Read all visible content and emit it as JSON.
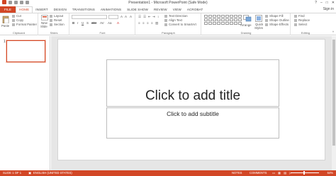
{
  "window": {
    "title": "Presentation1 - Microsoft PowerPoint (Safe Mode)",
    "controls": [
      "?",
      "–",
      "□",
      "✕"
    ],
    "sign_in": "Sign in"
  },
  "tabs": [
    "FILE",
    "HOME",
    "INSERT",
    "DESIGN",
    "TRANSITIONS",
    "ANIMATIONS",
    "SLIDE SHOW",
    "REVIEW",
    "VIEW",
    "ACROBAT"
  ],
  "ribbon": {
    "clipboard": {
      "label": "Clipboard",
      "paste": "Paste",
      "cut": "Cut",
      "copy": "Copy",
      "format_painter": "Format Painter"
    },
    "slides": {
      "label": "Slides",
      "new_slide": "New",
      "new_slide_2": "Slide",
      "layout": "Layout",
      "reset": "Reset",
      "section": "Section"
    },
    "font": {
      "label": "Font"
    },
    "paragraph": {
      "label": "Paragraph",
      "text_direction": "Text Direction",
      "align_text": "Align Text",
      "convert_smartart": "Convert to SmartArt"
    },
    "drawing": {
      "label": "Drawing",
      "arrange": "Arrange",
      "quick_styles": "Quick",
      "quick_styles_2": "Styles",
      "shape_fill": "Shape Fill",
      "shape_outline": "Shape Outline",
      "shape_effects": "Shape Effects"
    },
    "editing": {
      "label": "Editing",
      "find": "Find",
      "replace": "Replace",
      "select": "Select"
    }
  },
  "pane": {
    "slide_number": "1"
  },
  "slide": {
    "title_placeholder": "Click to add title",
    "subtitle_placeholder": "Click to add subtitle"
  },
  "status": {
    "slide_count": "SLIDE 1 OF 1",
    "language": "ENGLISH (UNITED STATES)",
    "notes": "NOTES",
    "comments": "COMMENTS",
    "zoom": "64%"
  },
  "colors": {
    "accent": "#d24726"
  }
}
